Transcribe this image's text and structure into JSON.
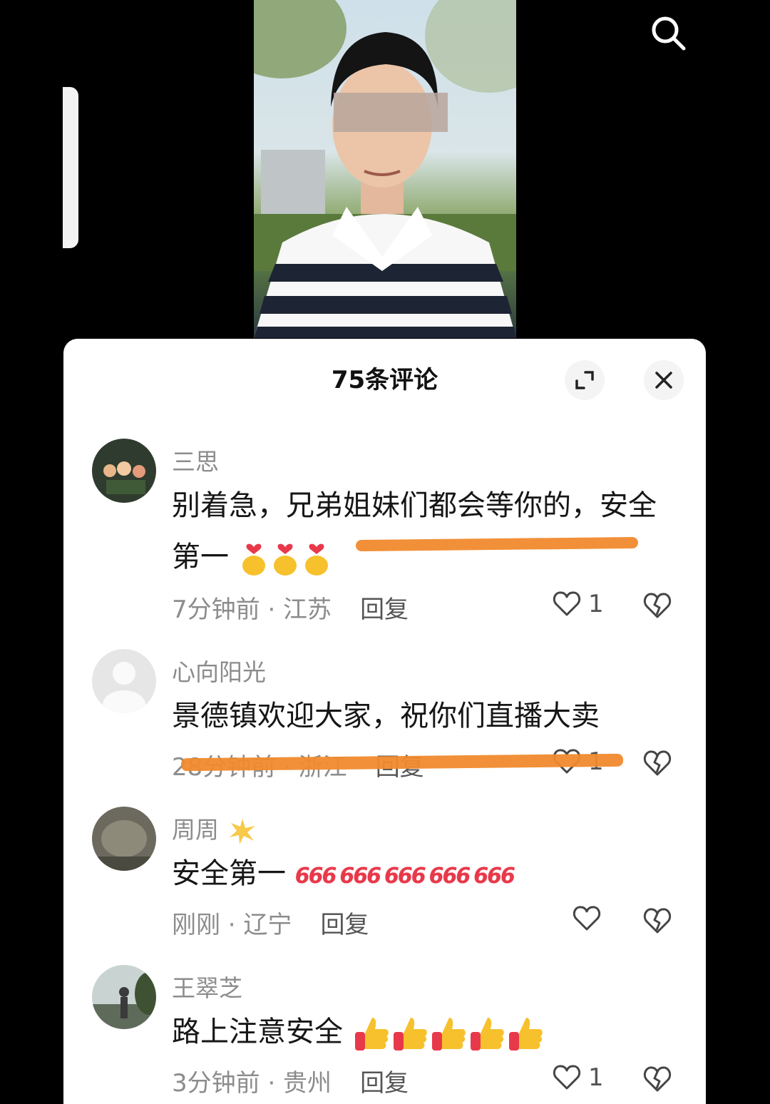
{
  "header": {
    "comment_count_title": "75条评论",
    "search_icon": "search-icon",
    "expand_icon": "expand-icon",
    "close_icon": "close-icon"
  },
  "comments": [
    {
      "name": "三思",
      "text": "别着急，兄弟姐妹们都会等你的，安全第一",
      "emoji": "heart-hands-emoji",
      "emoji_count": 3,
      "time_location": "7分钟前 · 江苏",
      "reply": "回复",
      "likes": "1"
    },
    {
      "name": "心向阳光",
      "text": "景德镇欢迎大家，祝你们直播大卖",
      "time_location": "28分钟前 · 浙江",
      "reply": "回复",
      "likes": "1"
    },
    {
      "name": "周周",
      "name_emoji": "sparkle-emoji",
      "text": "安全第一",
      "emoji_text": "666",
      "emoji_count": 5,
      "time_location": "刚刚 · 辽宁",
      "reply": "回复",
      "likes": ""
    },
    {
      "name": "王翠芝",
      "text": "路上注意安全",
      "emoji": "thumbs-up-emoji",
      "emoji_count": 5,
      "time_location": "3分钟前 · 贵州",
      "reply": "回复",
      "likes": "1"
    }
  ],
  "colors": {
    "sheet_background": "#ffffff",
    "secondary_text": "#8c8c8c",
    "primary_text": "#161616",
    "annotation_stroke": "#f08a2d",
    "emoji_red": "#e8394a",
    "emoji_yellow": "#f6c12c"
  }
}
